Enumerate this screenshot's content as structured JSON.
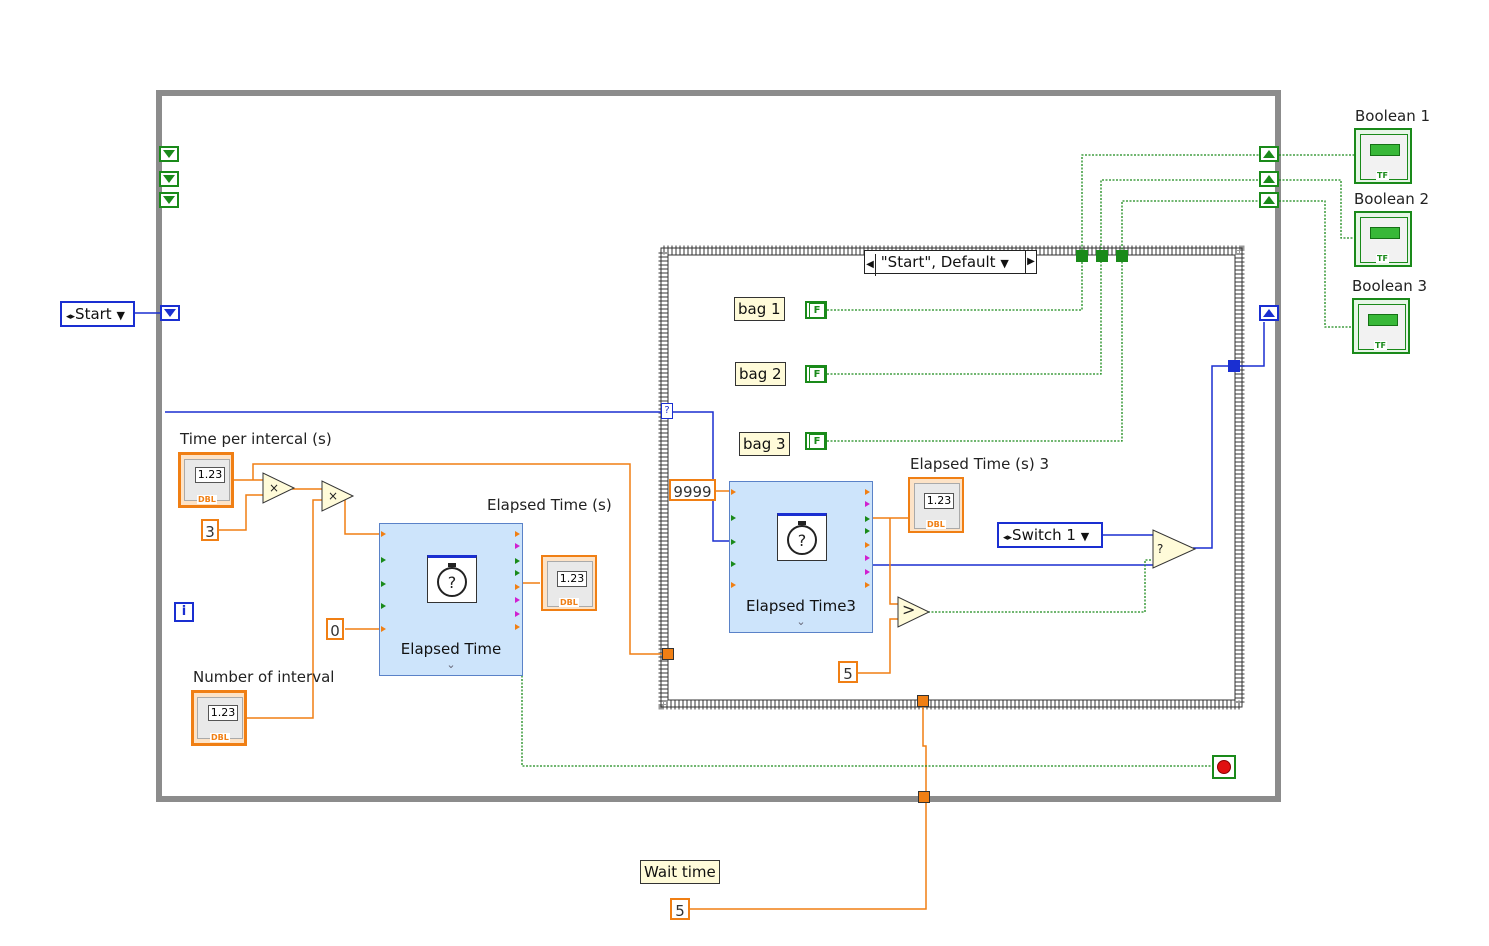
{
  "selector": {
    "label": "\"Start\", Default"
  },
  "start_ring": {
    "label": "Start"
  },
  "switch_ring": {
    "label": "Switch 1"
  },
  "constants": {
    "bag1": "bag 1",
    "bag2": "bag 2",
    "bag3": "bag 3",
    "false_glyph": "F",
    "three": "3",
    "zero": "0",
    "timeout": "9999",
    "five_inner": "5",
    "five_wait": "5",
    "wait_label": "Wait time"
  },
  "controls": {
    "time_per_interval": "Time per intercal (s)",
    "number_of_interval": "Number of interval"
  },
  "indicators": {
    "elapsed_time_s": "Elapsed Time (s)",
    "elapsed_time_s3": "Elapsed Time (s) 3",
    "boolean1": "Boolean 1",
    "boolean2": "Boolean 2",
    "boolean3": "Boolean 3"
  },
  "numeric_display": "1.23",
  "dbl_tag": "DBL",
  "tf_tag": "TF",
  "express_vis": {
    "elapsed1": "Elapsed Time",
    "elapsed3": "Elapsed Time3"
  },
  "operators": {
    "multiply": "×",
    "greater": ">",
    "select": "?"
  },
  "iteration_terminal": "i",
  "case_tunnel_glyph": "?",
  "chevron": "⌄",
  "colors": {
    "wire_numeric": "#f07f14",
    "wire_boolean": "#1a8a1a",
    "wire_enum": "#1a2fd1",
    "loop_border": "#8c8c8c",
    "express_vi_fill": "#cde4fb"
  }
}
